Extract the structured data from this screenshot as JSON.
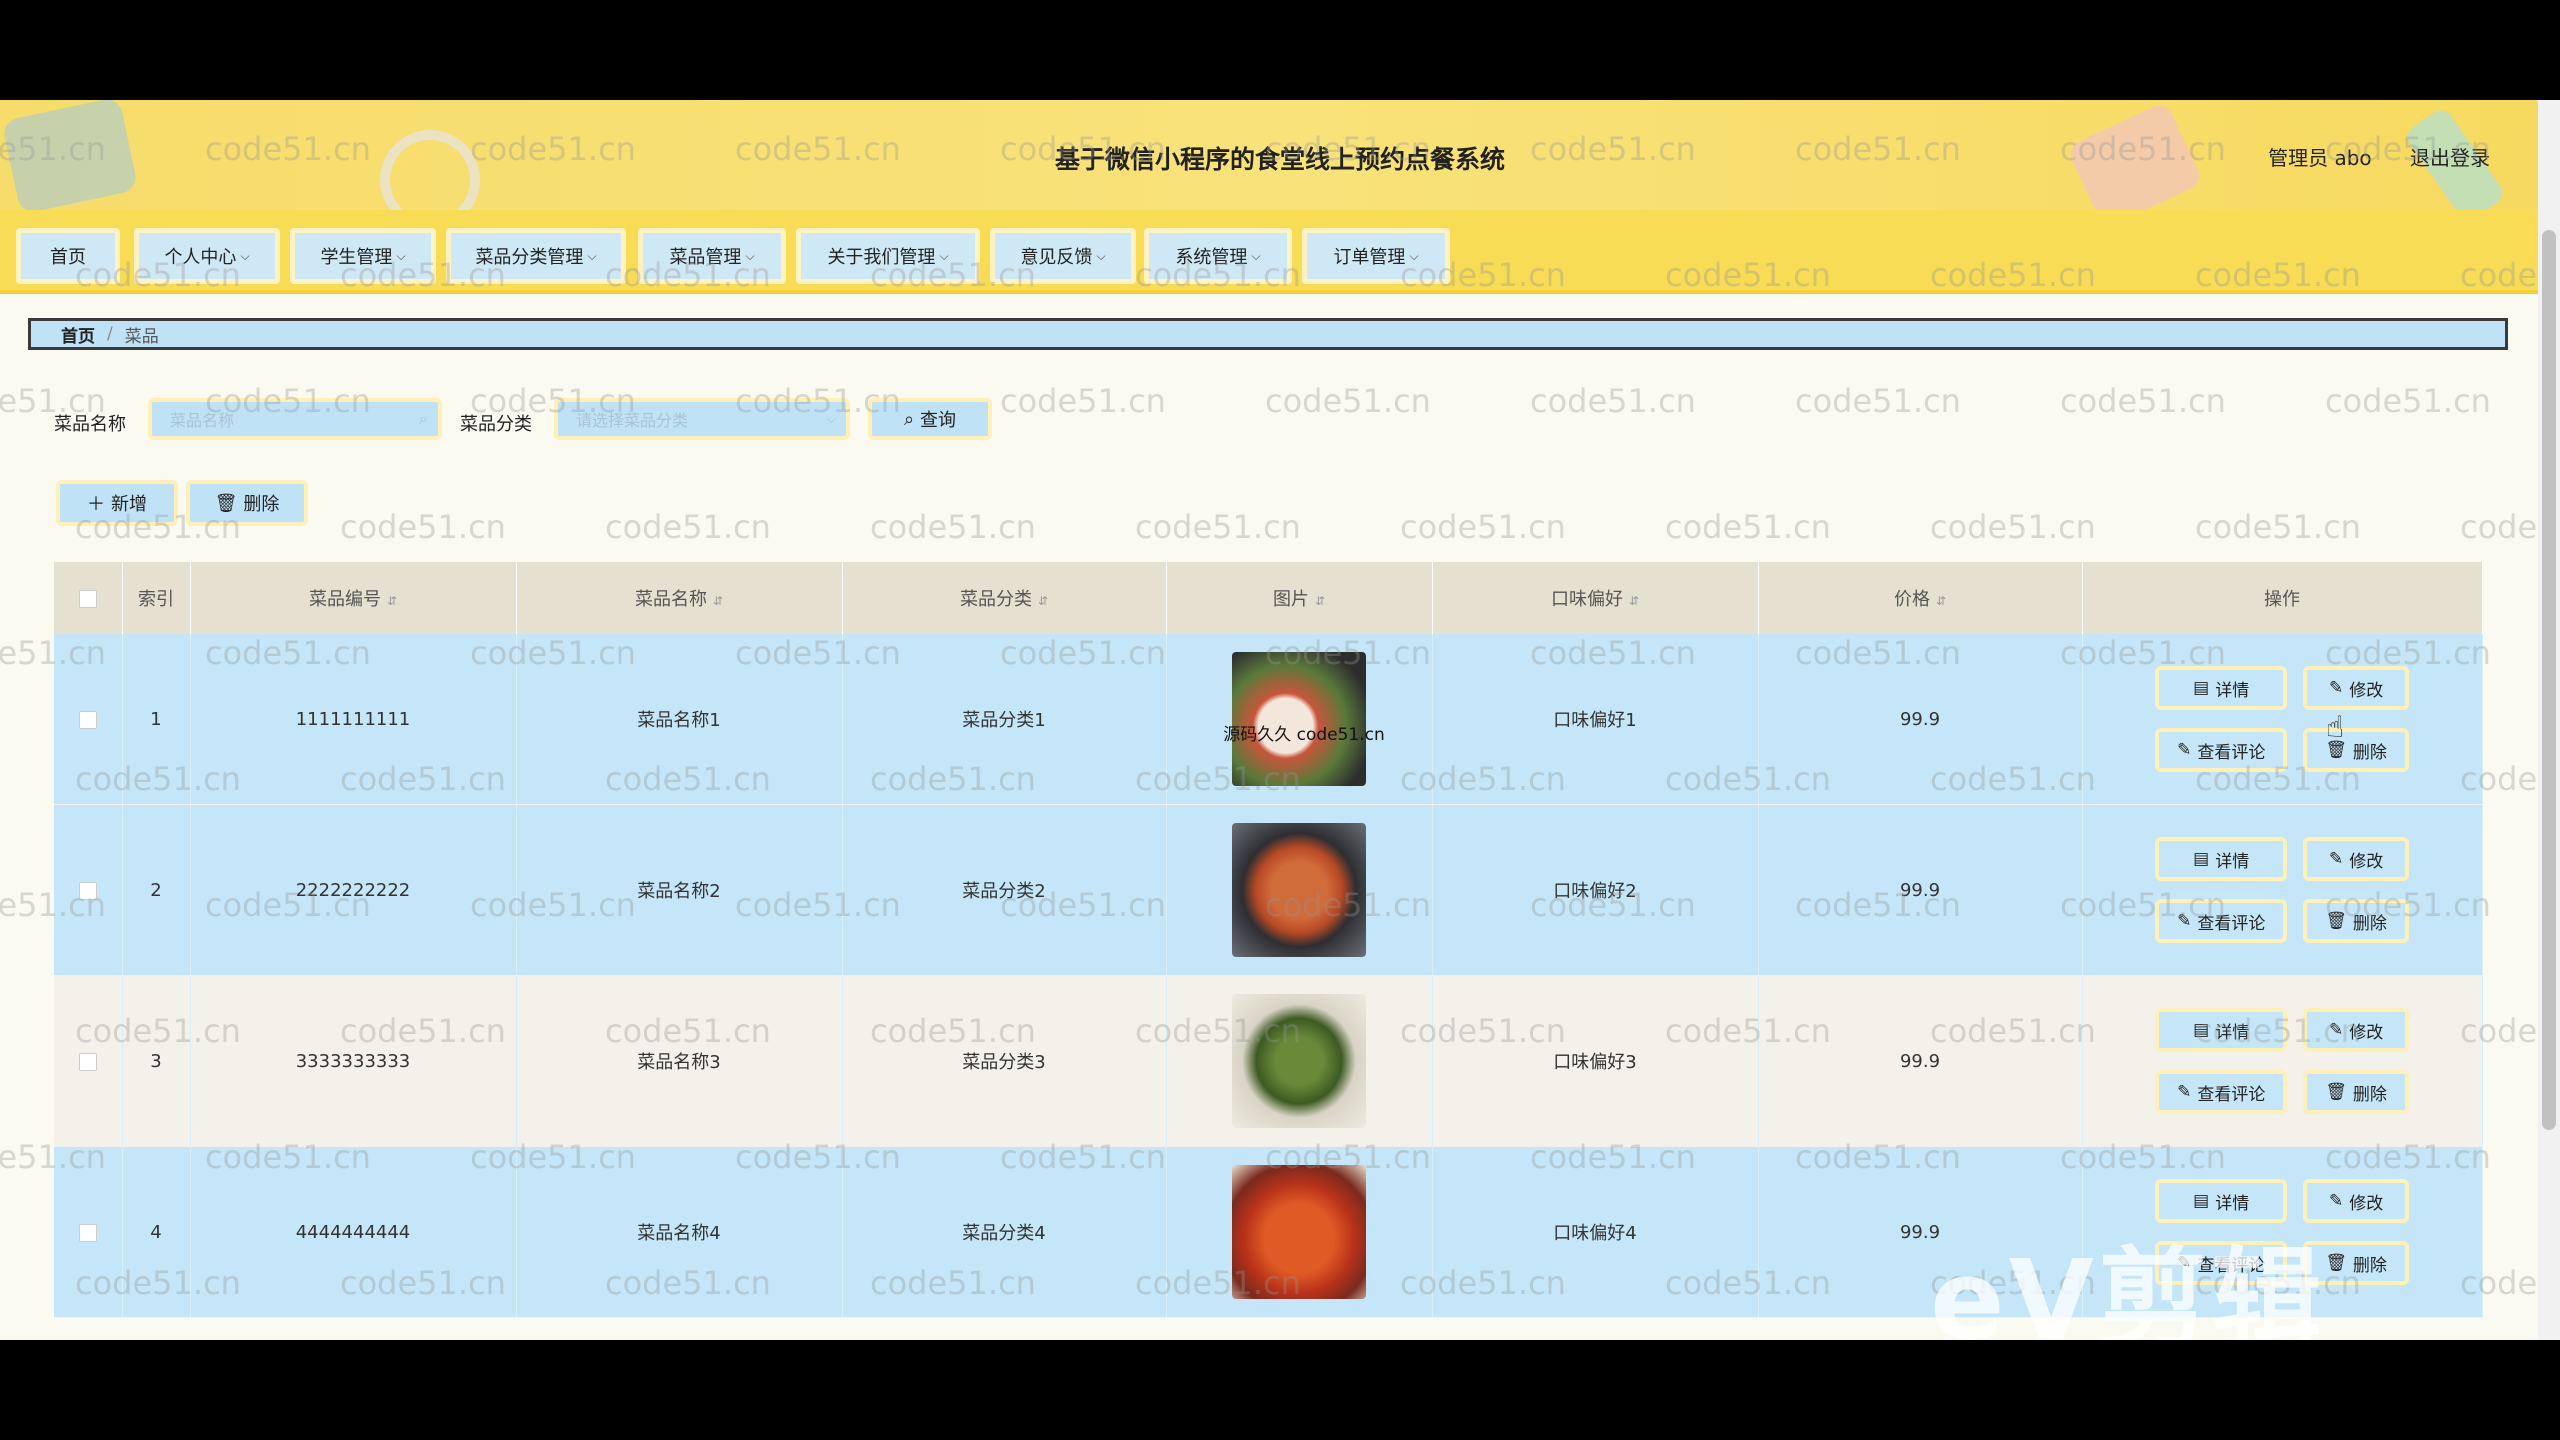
{
  "header": {
    "title": "基于微信小程序的食堂线上预约点餐系统",
    "user_label": "管理员 abo",
    "logout": "退出登录"
  },
  "nav": [
    {
      "label": "首页",
      "dropdown": false
    },
    {
      "label": "个人中心",
      "dropdown": true
    },
    {
      "label": "学生管理",
      "dropdown": true
    },
    {
      "label": "菜品分类管理",
      "dropdown": true
    },
    {
      "label": "菜品管理",
      "dropdown": true
    },
    {
      "label": "关于我们管理",
      "dropdown": true
    },
    {
      "label": "意见反馈",
      "dropdown": true
    },
    {
      "label": "系统管理",
      "dropdown": true
    },
    {
      "label": "订单管理",
      "dropdown": true
    }
  ],
  "breadcrumb": {
    "home": "首页",
    "current": "菜品"
  },
  "search": {
    "name_label": "菜品名称",
    "name_placeholder": "菜品名称",
    "category_label": "菜品分类",
    "category_placeholder": "请选择菜品分类",
    "query_button": "查询"
  },
  "actions": {
    "add": "新增",
    "delete": "删除"
  },
  "table": {
    "headers": [
      "索引",
      "菜品编号",
      "菜品名称",
      "菜品分类",
      "图片",
      "口味偏好",
      "价格",
      "操作"
    ],
    "rows": [
      {
        "index": "1",
        "code": "1111111111",
        "name": "菜品名称1",
        "category": "菜品分类1",
        "taste": "口味偏好1",
        "price": "99.9",
        "image_caption": "源码久久 code51.cn"
      },
      {
        "index": "2",
        "code": "2222222222",
        "name": "菜品名称2",
        "category": "菜品分类2",
        "taste": "口味偏好2",
        "price": "99.9"
      },
      {
        "index": "3",
        "code": "3333333333",
        "name": "菜品名称3",
        "category": "菜品分类3",
        "taste": "口味偏好3",
        "price": "99.9"
      },
      {
        "index": "4",
        "code": "4444444444",
        "name": "菜品名称4",
        "category": "菜品分类4",
        "taste": "口味偏好4",
        "price": "99.9"
      }
    ],
    "row_ops": {
      "detail": "详情",
      "edit": "修改",
      "comments": "查看评论",
      "delete": "删除"
    }
  },
  "watermark": "code51.cn",
  "overlay_logo": "eV剪辑",
  "colors": {
    "header": "#f8dc55",
    "button": "#c4e6f8",
    "button_border": "#fff0b8"
  }
}
